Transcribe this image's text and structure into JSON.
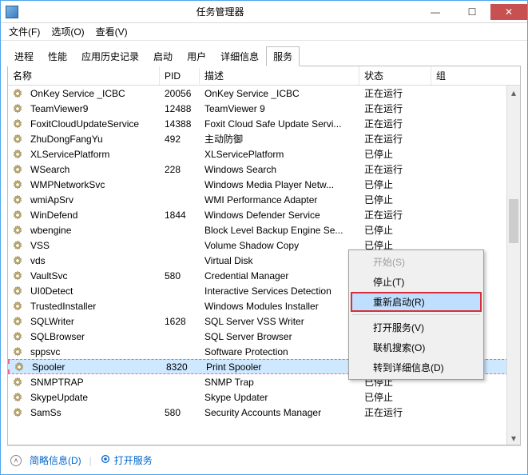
{
  "window": {
    "title": "任务管理器"
  },
  "menus": {
    "file": "文件(F)",
    "options": "选项(O)",
    "view": "查看(V)"
  },
  "tabs": [
    "进程",
    "性能",
    "应用历史记录",
    "启动",
    "用户",
    "详细信息",
    "服务"
  ],
  "active_tab_index": 6,
  "columns": {
    "name": "名称",
    "pid": "PID",
    "desc": "描述",
    "status": "状态",
    "group": "组"
  },
  "services": [
    {
      "name": "OnKey Service _ICBC",
      "pid": "20056",
      "desc": "OnKey Service _ICBC",
      "status": "正在运行"
    },
    {
      "name": "TeamViewer9",
      "pid": "12488",
      "desc": "TeamViewer 9",
      "status": "正在运行"
    },
    {
      "name": "FoxitCloudUpdateService",
      "pid": "14388",
      "desc": "Foxit Cloud Safe Update Servi...",
      "status": "正在运行"
    },
    {
      "name": "ZhuDongFangYu",
      "pid": "492",
      "desc": "主动防御",
      "status": "正在运行"
    },
    {
      "name": "XLServicePlatform",
      "pid": "",
      "desc": "XLServicePlatform",
      "status": "已停止"
    },
    {
      "name": "WSearch",
      "pid": "228",
      "desc": "Windows Search",
      "status": "正在运行"
    },
    {
      "name": "WMPNetworkSvc",
      "pid": "",
      "desc": "Windows Media Player Netw...",
      "status": "已停止"
    },
    {
      "name": "wmiApSrv",
      "pid": "",
      "desc": "WMI Performance Adapter",
      "status": "已停止"
    },
    {
      "name": "WinDefend",
      "pid": "1844",
      "desc": "Windows Defender Service",
      "status": "正在运行"
    },
    {
      "name": "wbengine",
      "pid": "",
      "desc": "Block Level Backup Engine Se...",
      "status": "已停止"
    },
    {
      "name": "VSS",
      "pid": "",
      "desc": "Volume Shadow Copy",
      "status": "已停止"
    },
    {
      "name": "vds",
      "pid": "",
      "desc": "Virtual Disk",
      "status": ""
    },
    {
      "name": "VaultSvc",
      "pid": "580",
      "desc": "Credential Manager",
      "status": ""
    },
    {
      "name": "UI0Detect",
      "pid": "",
      "desc": "Interactive Services Detection",
      "status": ""
    },
    {
      "name": "TrustedInstaller",
      "pid": "",
      "desc": "Windows Modules Installer",
      "status": ""
    },
    {
      "name": "SQLWriter",
      "pid": "1628",
      "desc": "SQL Server VSS Writer",
      "status": ""
    },
    {
      "name": "SQLBrowser",
      "pid": "",
      "desc": "SQL Server Browser",
      "status": ""
    },
    {
      "name": "sppsvc",
      "pid": "",
      "desc": "Software Protection",
      "status": ""
    },
    {
      "name": "Spooler",
      "pid": "8320",
      "desc": "Print Spooler",
      "status": "",
      "selected": true
    },
    {
      "name": "SNMPTRAP",
      "pid": "",
      "desc": "SNMP Trap",
      "status": "已停止"
    },
    {
      "name": "SkypeUpdate",
      "pid": "",
      "desc": "Skype Updater",
      "status": "已停止"
    },
    {
      "name": "SamSs",
      "pid": "580",
      "desc": "Security Accounts Manager",
      "status": "正在运行"
    }
  ],
  "context_menu": {
    "start": "开始(S)",
    "stop": "停止(T)",
    "restart": "重新启动(R)",
    "open_services": "打开服务(V)",
    "search_online": "联机搜索(O)",
    "go_details": "转到详细信息(D)"
  },
  "footer": {
    "brief": "简略信息(D)",
    "open_services": "打开服务"
  }
}
